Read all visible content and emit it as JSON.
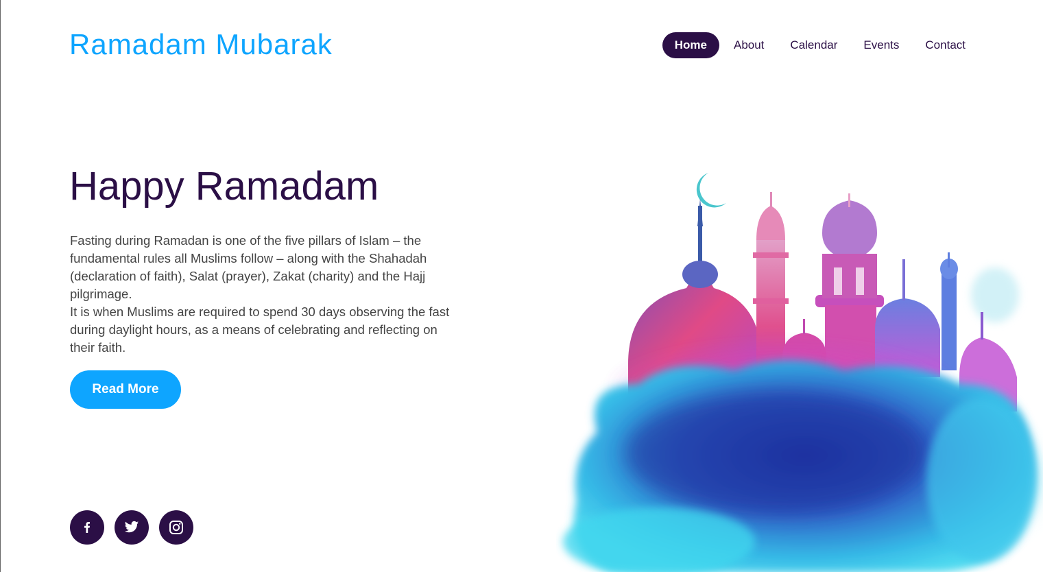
{
  "header": {
    "logo": "Ramadam Mubarak",
    "nav": [
      {
        "label": "Home",
        "active": true
      },
      {
        "label": "About",
        "active": false
      },
      {
        "label": "Calendar",
        "active": false
      },
      {
        "label": "Events",
        "active": false
      },
      {
        "label": "Contact",
        "active": false
      }
    ]
  },
  "hero": {
    "title": "Happy Ramadam",
    "paragraph_1": "Fasting during Ramadan is one of the five pillars of Islam – the fundamental rules all Muslims follow – along with the Shahadah (declaration of faith), Salat (prayer), Zakat (charity) and the Hajj pilgrimage.",
    "paragraph_2": "It is when Muslims are required to spend 30 days observing the fast during daylight hours, as a means of celebrating and reflecting on their faith.",
    "cta_label": "Read More"
  },
  "social": [
    {
      "icon": "facebook-icon"
    },
    {
      "icon": "twitter-icon"
    },
    {
      "icon": "instagram-icon"
    }
  ],
  "colors": {
    "brand_blue": "#0ea5ff",
    "dark_purple": "#2b0f46"
  }
}
